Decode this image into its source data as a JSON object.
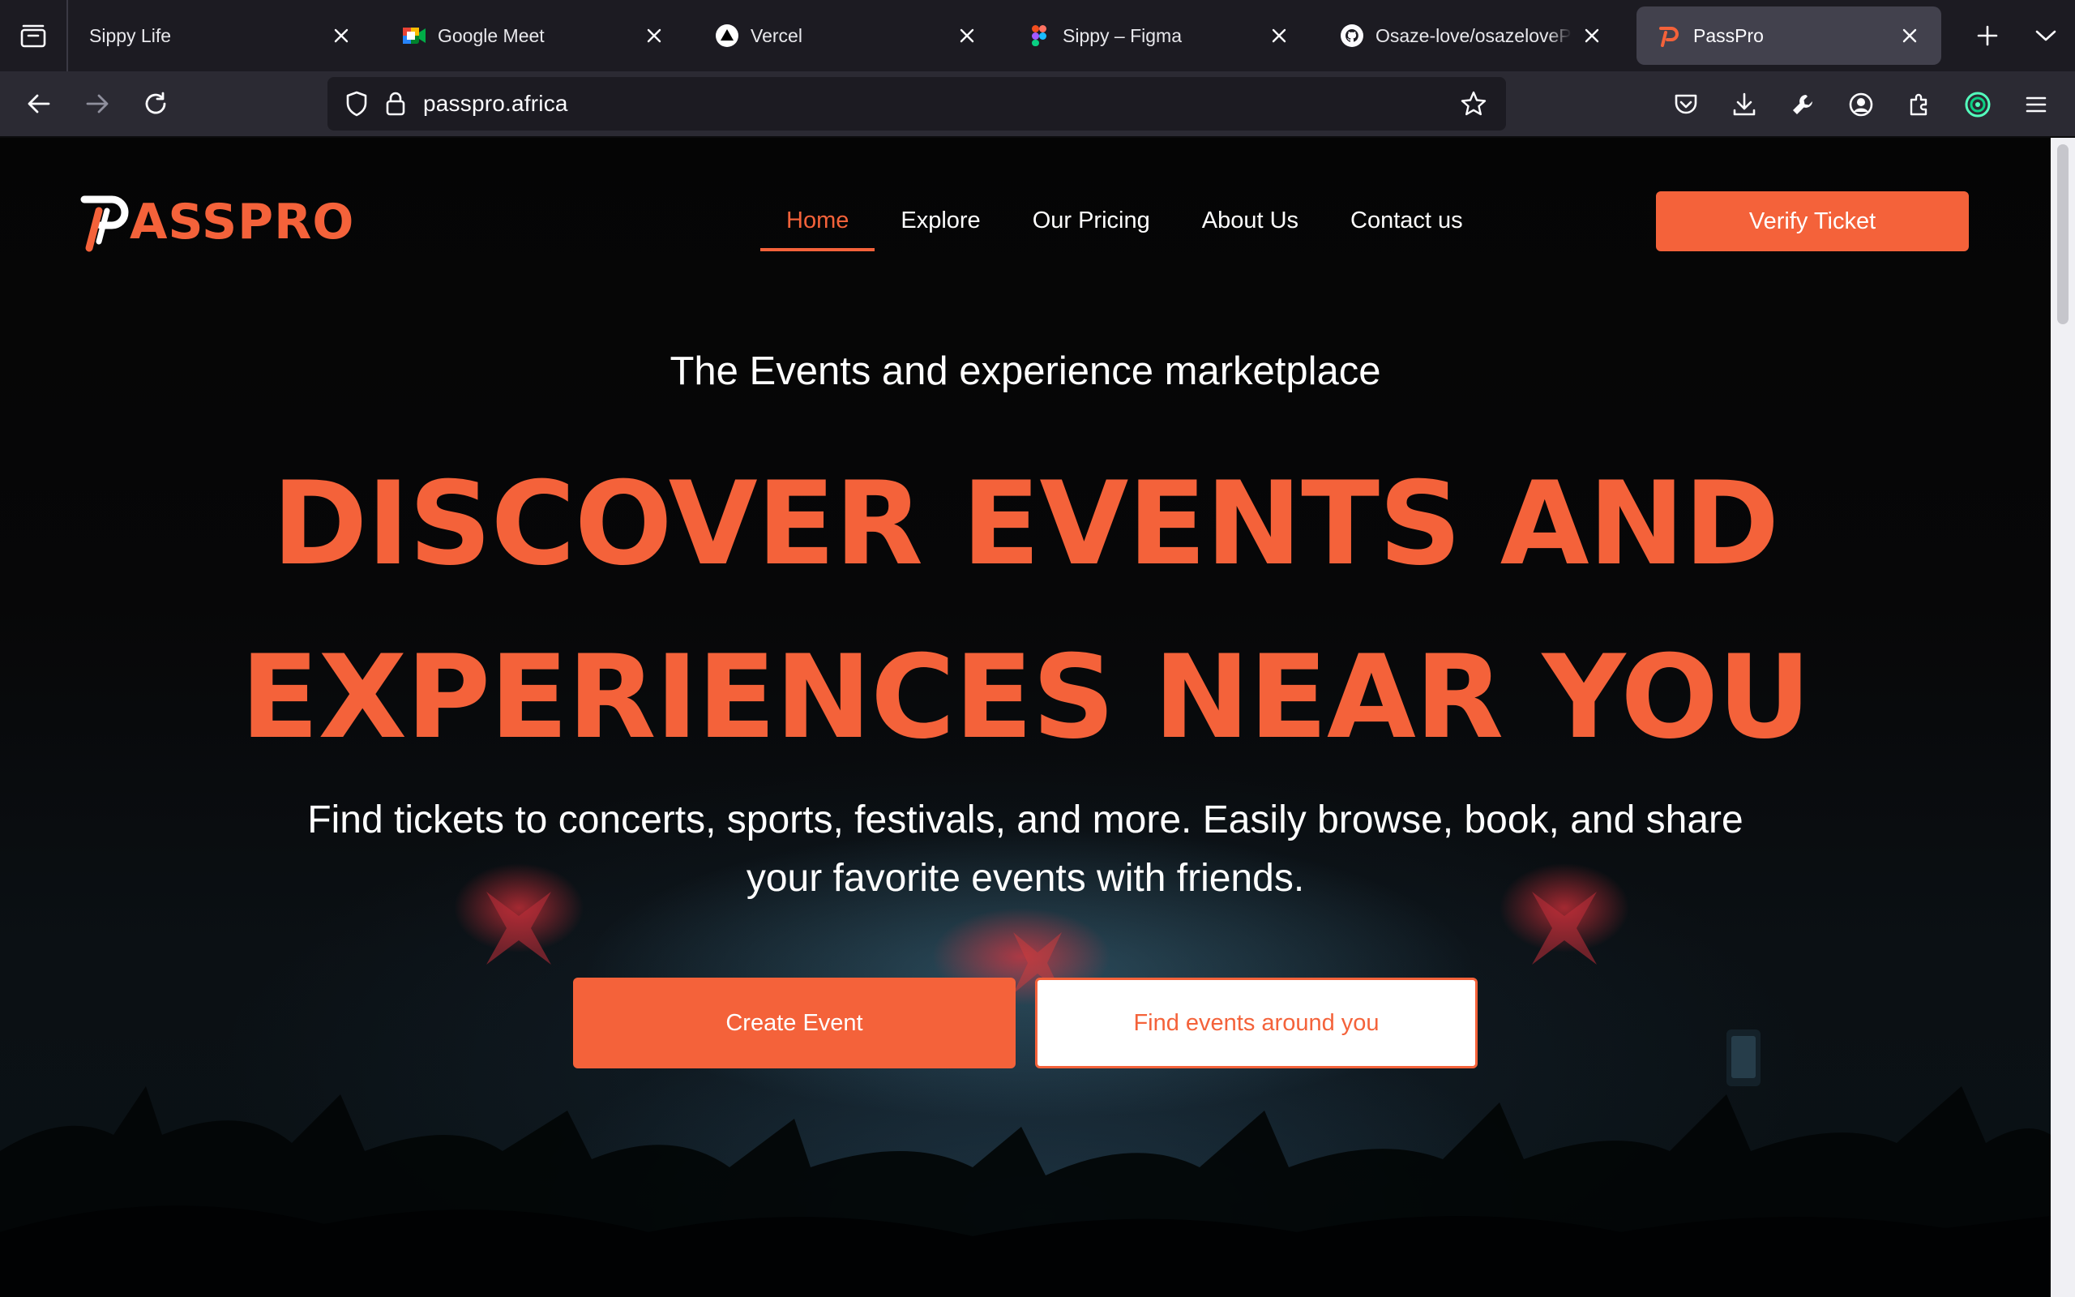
{
  "browser": {
    "tabs": [
      {
        "title": "Sippy Life",
        "icon": "none",
        "active": false
      },
      {
        "title": "Google Meet",
        "icon": "google-meet-icon",
        "active": false
      },
      {
        "title": "Vercel",
        "icon": "vercel-icon",
        "active": false
      },
      {
        "title": "Sippy – Figma",
        "icon": "figma-icon",
        "active": false
      },
      {
        "title": "Osaze-love/osazelovePort",
        "icon": "github-icon",
        "active": false
      },
      {
        "title": "PassPro",
        "icon": "passpro-icon",
        "active": true
      }
    ],
    "url": "passpro.africa"
  },
  "site": {
    "logo_text": "ASSPRO",
    "nav": [
      {
        "label": "Home",
        "active": true
      },
      {
        "label": "Explore",
        "active": false
      },
      {
        "label": "Our Pricing",
        "active": false
      },
      {
        "label": "About Us",
        "active": false
      },
      {
        "label": "Contact us",
        "active": false
      }
    ],
    "verify_label": "Verify Ticket"
  },
  "hero": {
    "eyebrow": "The Events and experience marketplace",
    "headline_line1": "DISCOVER EVENTS AND",
    "headline_line2": "EXPERIENCES NEAR YOU",
    "subtext_line1": "Find tickets to concerts, sports, festivals, and more. Easily browse, book, and share",
    "subtext_line2": "your favorite events with friends.",
    "primary_cta": "Create Event",
    "secondary_cta": "Find events around you"
  },
  "colors": {
    "brand": "#f4623a",
    "tabbar": "#1c1b22",
    "toolbar": "#2b2a33",
    "page_bg": "#000000"
  }
}
